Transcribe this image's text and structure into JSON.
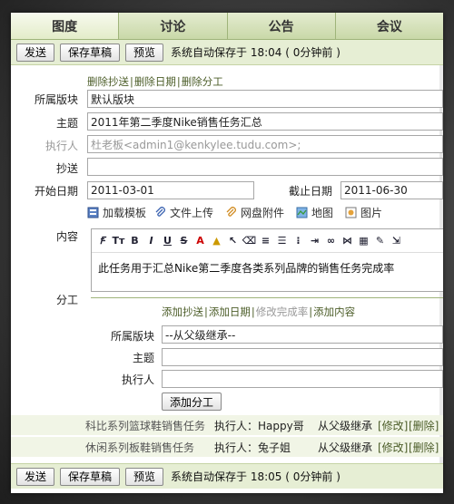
{
  "tabs": [
    {
      "label": "图度"
    },
    {
      "label": "讨论"
    },
    {
      "label": "公告"
    },
    {
      "label": "会议"
    }
  ],
  "toolbar": {
    "send": "发送",
    "save_draft": "保存草稿",
    "preview": "预览",
    "autosave": "系统自动保存于 18:04 ( 0分钟前 )"
  },
  "top_links": [
    "删除抄送",
    "删除日期",
    "删除分工"
  ],
  "form": {
    "board_label": "所属版块",
    "board_value": "默认版块",
    "subject_label": "主题",
    "subject_value": "2011年第二季度Nike销售任务汇总",
    "executor_label": "执行人",
    "executor_value": "杜老板<admin1@kenkylee.tudu.com>;",
    "cc_label": "抄送",
    "cc_value": "",
    "start_label": "开始日期",
    "start_value": "2011-03-01",
    "end_label": "截止日期",
    "end_value": "2011-06-30"
  },
  "attach_tools": [
    {
      "label": "加载模板",
      "icon": "template-icon"
    },
    {
      "label": "文件上传",
      "icon": "paperclip-icon"
    },
    {
      "label": "网盘附件",
      "icon": "netdisk-icon"
    },
    {
      "label": "地图",
      "icon": "map-icon"
    },
    {
      "label": "图片",
      "icon": "image-icon"
    }
  ],
  "content": {
    "label": "内容",
    "text": "此任务用于汇总Nike第二季度各类系列品牌的销售任务完成率"
  },
  "division": {
    "label": "分工",
    "links": [
      "添加抄送",
      "添加日期",
      "修改完成率",
      "添加内容"
    ],
    "board_label": "所属版块",
    "board_value": "--从父级继承--",
    "subject_label": "主题",
    "executor_label": "执行人",
    "add_button": "添加分工"
  },
  "tasks": [
    {
      "name": "科比系列篮球鞋销售任务",
      "executor": "执行人：Happy哥",
      "inherit": "从父级继承",
      "edit": "[修改]",
      "delete": "[删除]"
    },
    {
      "name": "休闲系列板鞋销售任务",
      "executor": "执行人：兔子姐",
      "inherit": "从父级继承",
      "edit": "[修改]",
      "delete": "[删除]"
    }
  ],
  "bottom_toolbar": {
    "send": "发送",
    "save_draft": "保存草稿",
    "preview": "预览",
    "autosave": "系统自动保存于 18:05 ( 0分钟前 )"
  },
  "colors": {
    "tab_bg": "#cfdcb1",
    "toolbar_bg": "#e6eed4",
    "link": "#4d5e2a"
  }
}
